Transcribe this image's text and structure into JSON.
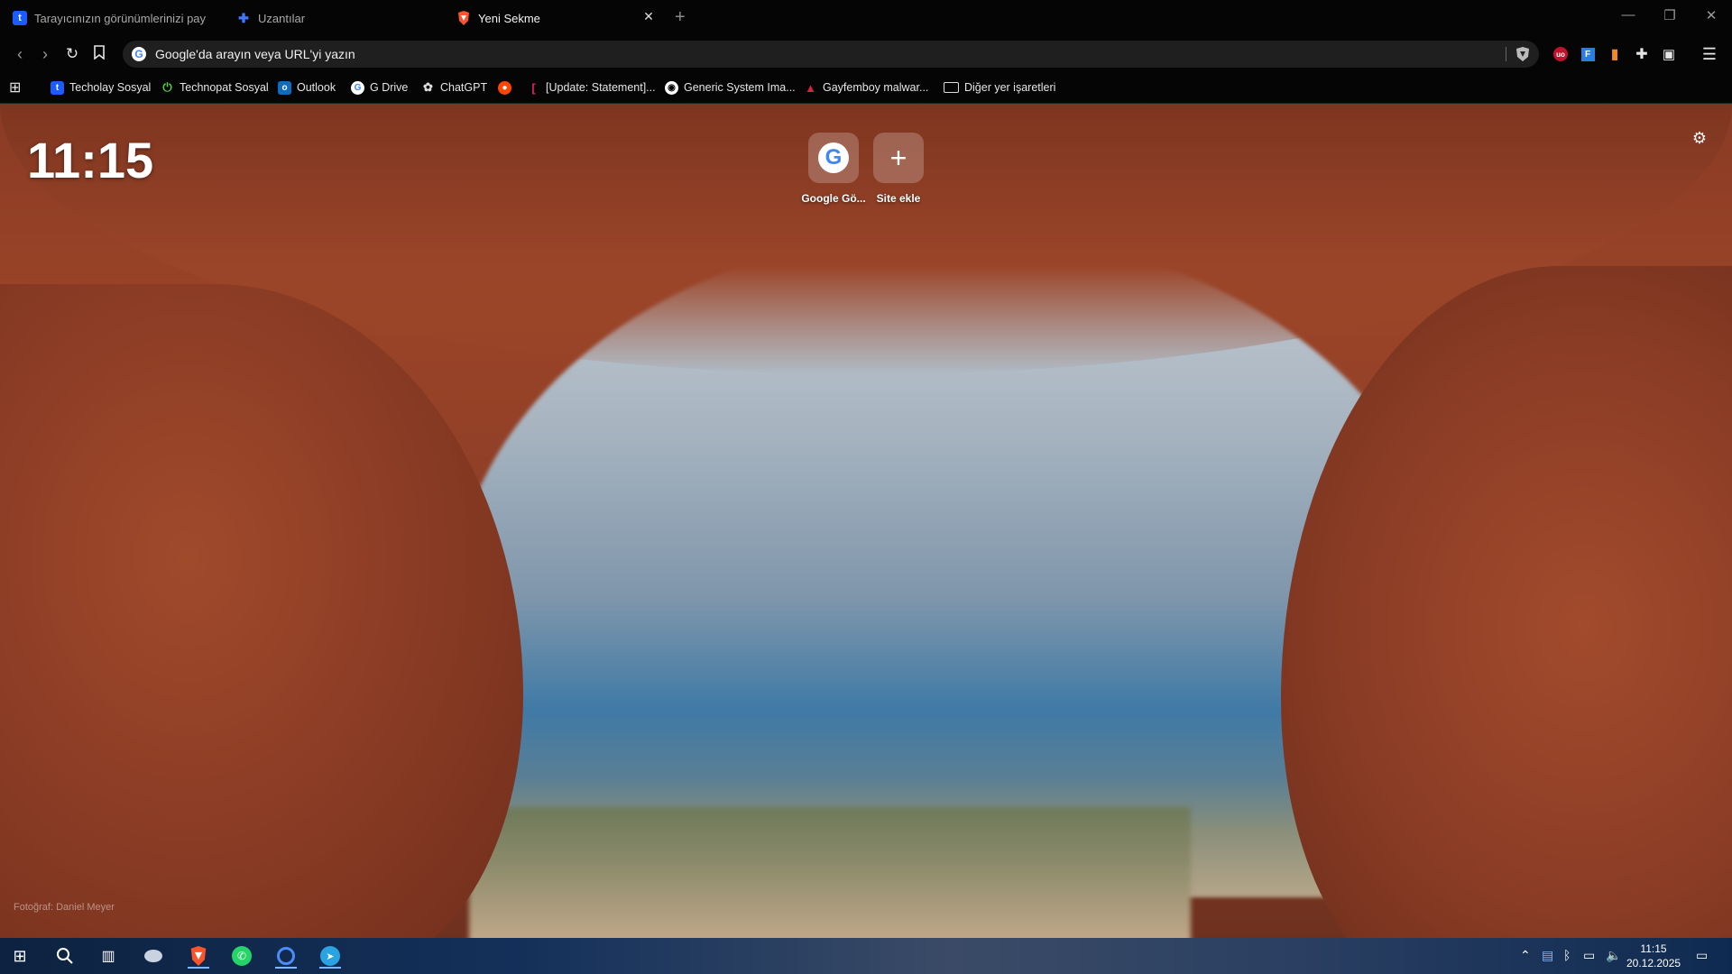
{
  "tabs": [
    {
      "label": "Tarayıcınızın görünümlerinizi paylaşın",
      "icon": "techolay-icon",
      "active": false
    },
    {
      "label": "Uzantılar",
      "icon": "puzzle-icon",
      "active": false
    },
    {
      "label": "Yeni Sekme",
      "icon": "brave-icon",
      "active": true
    }
  ],
  "omnibox": {
    "placeholder": "Google'da arayın veya URL'yi yazın"
  },
  "bookmarks": [
    {
      "label": "Techolay Sosyal",
      "icon": "techolay-icon"
    },
    {
      "label": "Technopat Sosyal",
      "icon": "power-icon"
    },
    {
      "label": "Outlook",
      "icon": "outlook-icon"
    },
    {
      "label": "G Drive",
      "icon": "google-icon"
    },
    {
      "label": "ChatGPT",
      "icon": "openai-icon"
    },
    {
      "label": "",
      "icon": "reddit-icon"
    },
    {
      "label": "[Update: Statement]...",
      "icon": "bracket-icon"
    },
    {
      "label": "Generic System Ima...",
      "icon": "github-icon"
    },
    {
      "label": "Gayfemboy malwar...",
      "icon": "cloud-icon"
    },
    {
      "label": "Diğer yer işaretleri",
      "icon": "folder-icon"
    }
  ],
  "newtab": {
    "clock": "11:15",
    "tiles": [
      {
        "label": "Google Gö...",
        "icon": "google-icon"
      },
      {
        "label": "Site ekle",
        "icon": "plus-icon"
      }
    ],
    "photo_credit": "Fotoğraf: Daniel Meyer"
  },
  "taskbar": {
    "time": "11:15",
    "date": "20.12.2025"
  },
  "colors": {
    "accent": "#7fb6ff",
    "brave": "#fb542b"
  }
}
